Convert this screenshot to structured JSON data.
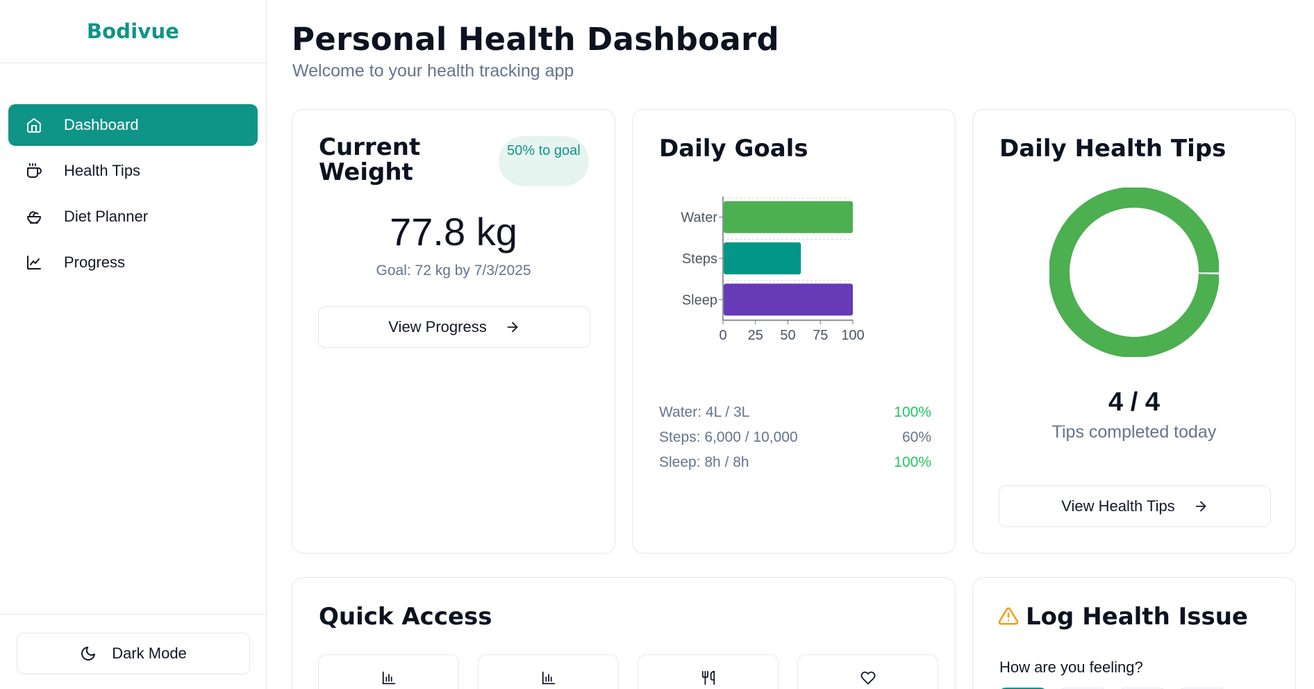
{
  "app": {
    "brand": "Bodivue"
  },
  "sidebar": {
    "items": [
      {
        "label": "Dashboard",
        "icon": "home-icon",
        "active": true
      },
      {
        "label": "Health Tips",
        "icon": "coffee-icon",
        "active": false
      },
      {
        "label": "Diet Planner",
        "icon": "salad-icon",
        "active": false
      },
      {
        "label": "Progress",
        "icon": "line-chart-icon",
        "active": false
      }
    ],
    "dark_mode_label": "Dark Mode"
  },
  "header": {
    "title": "Personal Health Dashboard",
    "subtitle": "Welcome to your health tracking app"
  },
  "weight_card": {
    "title": "Current Weight",
    "badge": "50% to goal",
    "value": "77.8 kg",
    "goal": "Goal: 72 kg by 7/3/2025",
    "button": "View Progress"
  },
  "goals_card": {
    "title": "Daily Goals",
    "rows": [
      {
        "label": "Water: 4L / 3L",
        "percent": "100%",
        "done": true
      },
      {
        "label": "Steps: 6,000 / 10,000",
        "percent": "60%",
        "done": false
      },
      {
        "label": "Sleep: 8h / 8h",
        "percent": "100%",
        "done": true
      }
    ]
  },
  "chart_data": {
    "type": "bar",
    "orientation": "horizontal",
    "categories": [
      "Water",
      "Steps",
      "Sleep"
    ],
    "values": [
      100,
      60,
      100
    ],
    "colors": [
      "#4caf50",
      "#009688",
      "#673ab7"
    ],
    "xticks": [
      "0",
      "25",
      "50",
      "75",
      "100"
    ],
    "xlim": [
      0,
      100
    ],
    "title": "",
    "xlabel": "",
    "ylabel": ""
  },
  "tips_card": {
    "title": "Daily Health Tips",
    "completed": 4,
    "total": 4,
    "count_text": "4 / 4",
    "label": "Tips completed today",
    "button": "View Health Tips",
    "ring_color": "#4caf50"
  },
  "quick_access": {
    "title": "Quick Access",
    "tiles": [
      {
        "icon": "bar-chart-icon"
      },
      {
        "icon": "bar-chart-icon"
      },
      {
        "icon": "utensils-icon"
      },
      {
        "icon": "heart-icon"
      }
    ]
  },
  "log_card": {
    "title": "Log Health Issue",
    "question": "How are you feeling?"
  },
  "colors": {
    "accent": "#0f9488",
    "success": "#22c55e",
    "muted": "#64748b",
    "warning": "#f59e0b"
  }
}
